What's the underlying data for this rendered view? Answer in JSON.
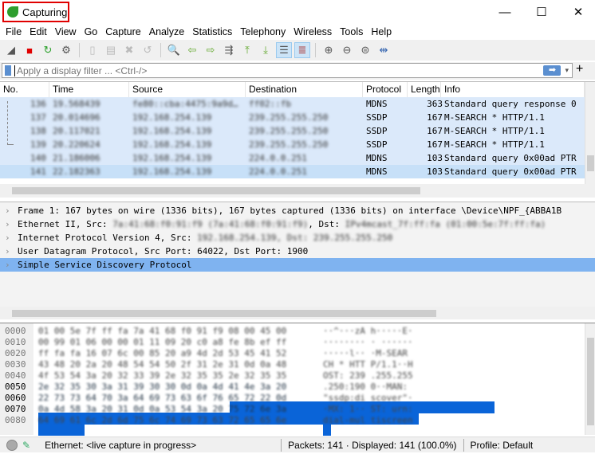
{
  "window": {
    "title": "Capturing",
    "controls": [
      "minimize",
      "maximize",
      "close"
    ]
  },
  "menu": [
    "File",
    "Edit",
    "View",
    "Go",
    "Capture",
    "Analyze",
    "Statistics",
    "Telephony",
    "Wireless",
    "Tools",
    "Help"
  ],
  "toolbar": [
    "start-capture-icon",
    "stop-capture-icon",
    "restart-capture-icon",
    "capture-options-icon",
    "open-file-icon",
    "save-file-icon",
    "close-file-icon",
    "reload-icon",
    "find-packet-icon",
    "go-back-icon",
    "go-forward-icon",
    "go-to-packet-icon",
    "first-packet-icon",
    "last-packet-icon",
    "autoscroll-icon",
    "colorize-icon",
    "zoom-in-icon",
    "zoom-out-icon",
    "zoom-normal-icon",
    "resize-columns-icon"
  ],
  "filter": {
    "placeholder": "Apply a display filter ... <Ctrl-/>",
    "value": ""
  },
  "packet_list": {
    "columns": [
      "No.",
      "Time",
      "Source",
      "Destination",
      "Protocol",
      "Length",
      "Info"
    ],
    "rows": [
      {
        "no": "136",
        "time": "19.568439",
        "src": "fe80::cba:4475:9a9d…",
        "dst": "ff02::fb",
        "proto": "MDNS",
        "len": "363",
        "info": "Standard query response 0"
      },
      {
        "no": "137",
        "time": "20.014696",
        "src": "192.168.254.139",
        "dst": "239.255.255.250",
        "proto": "SSDP",
        "len": "167",
        "info": "M-SEARCH * HTTP/1.1"
      },
      {
        "no": "138",
        "time": "20.117021",
        "src": "192.168.254.139",
        "dst": "239.255.255.250",
        "proto": "SSDP",
        "len": "167",
        "info": "M-SEARCH * HTTP/1.1"
      },
      {
        "no": "139",
        "time": "20.220624",
        "src": "192.168.254.139",
        "dst": "239.255.255.250",
        "proto": "SSDP",
        "len": "167",
        "info": "M-SEARCH * HTTP/1.1"
      },
      {
        "no": "140",
        "time": "21.186006",
        "src": "192.168.254.139",
        "dst": "224.0.0.251",
        "proto": "MDNS",
        "len": "103",
        "info": "Standard query 0x00ad PTR"
      },
      {
        "no": "141",
        "time": "22.182363",
        "src": "192.168.254.139",
        "dst": "224.0.0.251",
        "proto": "MDNS",
        "len": "103",
        "info": "Standard query 0x00ad PTR"
      }
    ],
    "selected_no": "141"
  },
  "details": [
    {
      "text": "Frame 1: 167 bytes on wire (1336 bits), 167 bytes captured (1336 bits) on interface \\Device\\NPF_{ABBA1B"
    },
    {
      "text": "Ethernet II, Src: ",
      "blur": "7a:41:68:f0:91:f9 (7a:41:68:f0:91:f9)",
      "text2": ", Dst: ",
      "blur2": "IPv4mcast_7f:ff:fa (01:00:5e:7f:ff:fa)"
    },
    {
      "text": "Internet Protocol Version 4, Src: ",
      "blur": "192.168.254.139, Dst: 239.255.255.250"
    },
    {
      "text": "User Datagram Protocol, Src Port: 64022, Dst Port: 1900"
    },
    {
      "text": "Simple Service Discovery Protocol",
      "selected": true
    }
  ],
  "bytes": [
    {
      "off": "0000",
      "hex": "01 00 5e 7f ff fa 7a 41  68 f0 91 f9 08 00 45 00",
      "ascii": "··^···zA h·····E·"
    },
    {
      "off": "0010",
      "hex": "00 99 01 06 00 00 01 11  09 20 c0 a8 fe 8b ef ff",
      "ascii": "········ · ······"
    },
    {
      "off": "0020",
      "hex": "ff fa fa 16 07 6c 00 85  20 a9 4d 2d 53 45 41 52",
      "ascii": "·····l··  ·M-SEAR"
    },
    {
      "off": "0030",
      "hex": "43 48 20 2a 20 48 54 54  50 2f 31 2e 31 0d 0a 48",
      "ascii": "CH * HTT P/1.1··H"
    },
    {
      "off": "0040",
      "hex": "4f 53 54 3a 20 32 33 39  2e 32 35 35 2e 32 35 35",
      "ascii": "OST: 239 .255.255"
    },
    {
      "off": "0050",
      "hex": "2e 32 35 30 3a 31 39 30  30 0d 0a 4d 41 4e 3a 20",
      "ascii": ".250:190 0··MAN: "
    },
    {
      "off": "0060",
      "hex": "22 73 73 64 70 3a 64 69  73 63 6f 76 65 72 22 0d",
      "ascii": "\"ssdp:di scover\"·"
    },
    {
      "off": "0070",
      "hex": "0a 4d 58 3a 20 31 0d 0a  53 54 3a 20 75 72 6e 3a",
      "ascii": "·MX: 1·· ST: urn:"
    },
    {
      "off": "0080",
      "hex": "64 69 61 6c 2d 6d 75 6c  74 69 73 63 72 65 65 6e",
      "ascii": "dial-mul tiscreen"
    }
  ],
  "status": {
    "interface": "Ethernet: <live capture in progress>",
    "packets": "Packets: 141 · Displayed: 141 (100.0%)",
    "profile": "Profile: Default"
  },
  "colors": {
    "row_bg": "#dbe9fa",
    "selected_row": "#c7e0f8",
    "detail_selected": "#7fb3f0",
    "bytes_highlight": "#0a64d8",
    "title_highlight_box": "#e00000"
  }
}
